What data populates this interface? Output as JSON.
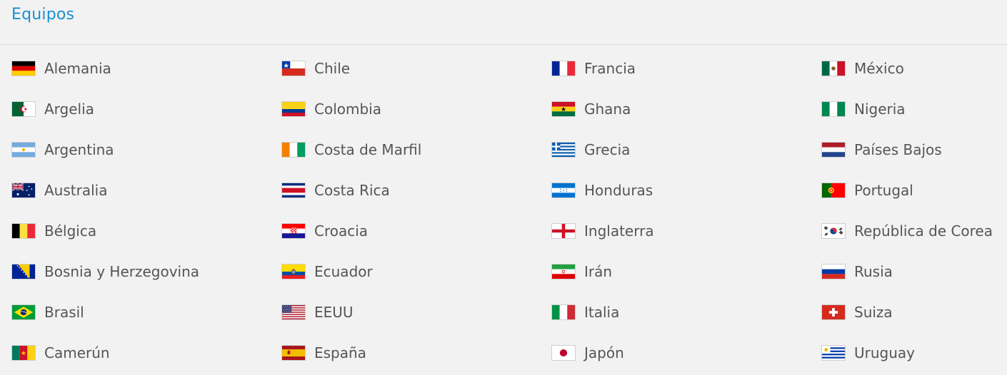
{
  "section": {
    "title": "Equipos"
  },
  "teams": [
    {
      "name": "Alemania",
      "flag": "germany-flag-icon"
    },
    {
      "name": "Chile",
      "flag": "chile-flag-icon"
    },
    {
      "name": "Francia",
      "flag": "france-flag-icon"
    },
    {
      "name": "México",
      "flag": "mexico-flag-icon"
    },
    {
      "name": "Argelia",
      "flag": "algeria-flag-icon"
    },
    {
      "name": "Colombia",
      "flag": "colombia-flag-icon"
    },
    {
      "name": "Ghana",
      "flag": "ghana-flag-icon"
    },
    {
      "name": "Nigeria",
      "flag": "nigeria-flag-icon"
    },
    {
      "name": "Argentina",
      "flag": "argentina-flag-icon"
    },
    {
      "name": "Costa de Marfil",
      "flag": "ivory-coast-flag-icon"
    },
    {
      "name": "Grecia",
      "flag": "greece-flag-icon"
    },
    {
      "name": "Países Bajos",
      "flag": "netherlands-flag-icon"
    },
    {
      "name": "Australia",
      "flag": "australia-flag-icon"
    },
    {
      "name": "Costa Rica",
      "flag": "costa-rica-flag-icon"
    },
    {
      "name": "Honduras",
      "flag": "honduras-flag-icon"
    },
    {
      "name": "Portugal",
      "flag": "portugal-flag-icon"
    },
    {
      "name": "Bélgica",
      "flag": "belgium-flag-icon"
    },
    {
      "name": "Croacia",
      "flag": "croatia-flag-icon"
    },
    {
      "name": "Inglaterra",
      "flag": "england-flag-icon"
    },
    {
      "name": "República de Corea",
      "flag": "south-korea-flag-icon"
    },
    {
      "name": "Bosnia y Herzegovina",
      "flag": "bosnia-flag-icon"
    },
    {
      "name": "Ecuador",
      "flag": "ecuador-flag-icon"
    },
    {
      "name": "Irán",
      "flag": "iran-flag-icon"
    },
    {
      "name": "Rusia",
      "flag": "russia-flag-icon"
    },
    {
      "name": "Brasil",
      "flag": "brazil-flag-icon"
    },
    {
      "name": "EEUU",
      "flag": "usa-flag-icon"
    },
    {
      "name": "Italia",
      "flag": "italy-flag-icon"
    },
    {
      "name": "Suiza",
      "flag": "switzerland-flag-icon"
    },
    {
      "name": "Camerún",
      "flag": "cameroon-flag-icon"
    },
    {
      "name": "España",
      "flag": "spain-flag-icon"
    },
    {
      "name": "Japón",
      "flag": "japan-flag-icon"
    },
    {
      "name": "Uruguay",
      "flag": "uruguay-flag-icon"
    }
  ],
  "colors": {
    "title": "#1a8fd6",
    "label": "#555555",
    "background": "#f2f2f2"
  }
}
